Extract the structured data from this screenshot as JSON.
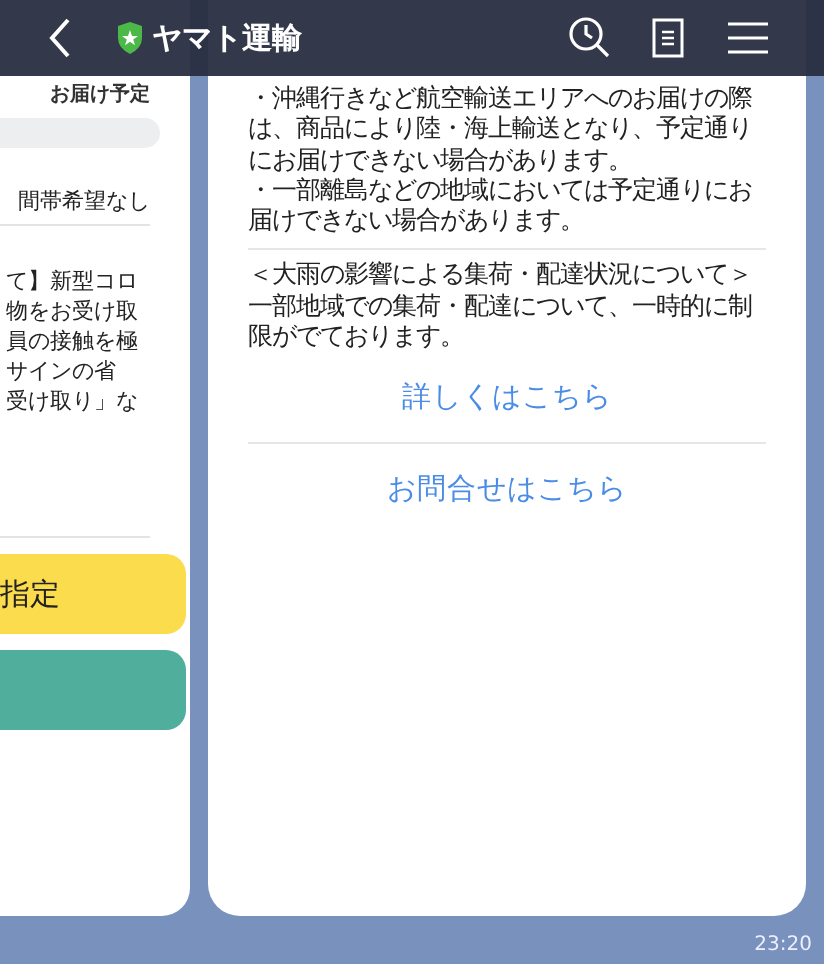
{
  "header": {
    "title": "ヤマト運輸"
  },
  "left_card": {
    "label": "お届け予定",
    "time_slot": "間帯希望なし",
    "paragraph": [
      "て】新型コロ",
      "物をお受け取",
      "員の接触を極",
      "サインの省",
      "受け取り」な"
    ],
    "buttons": [
      {
        "label": "指定",
        "kind": "yellow"
      },
      {
        "kind": "green"
      }
    ]
  },
  "right_card": {
    "notice": [
      "・沖縄行きなど航空輸送エリアへのお届けの際",
      "は、商品により陸・海上輸送となり、予定通り",
      "にお届けできない場合があります。",
      "・一部離島などの地域においては予定通りにお",
      "届けできない場合があります。"
    ],
    "notice_2": [
      "＜大雨の影響による集荷・配達状況について＞",
      "一部地域での集荷・配達について、一時的に制",
      "限がでております。"
    ],
    "links": [
      "詳しくはこちら",
      "お問合せはこちら"
    ]
  },
  "timestamp": "23:20"
}
